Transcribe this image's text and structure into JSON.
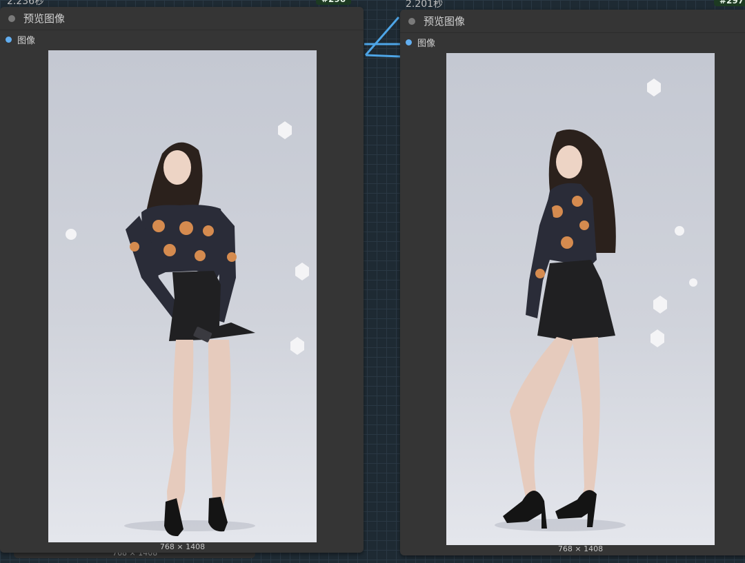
{
  "left_node": {
    "timing": "2.236秒",
    "badge": "#296",
    "title": "预览图像",
    "port_label": "图像",
    "dimensions": "768 × 1408",
    "back_dimensions": "768 × 1408"
  },
  "right_node": {
    "timing": "2.201秒",
    "badge": "#297",
    "title": "预览图像",
    "port_label": "图像",
    "dimensions": "768 × 1408"
  },
  "colors": {
    "canvas": "#1e2a33",
    "node_bg": "#353535",
    "port": "#62aef0",
    "link": "#4ea6e8",
    "badge_bg": "#1d3a22"
  }
}
